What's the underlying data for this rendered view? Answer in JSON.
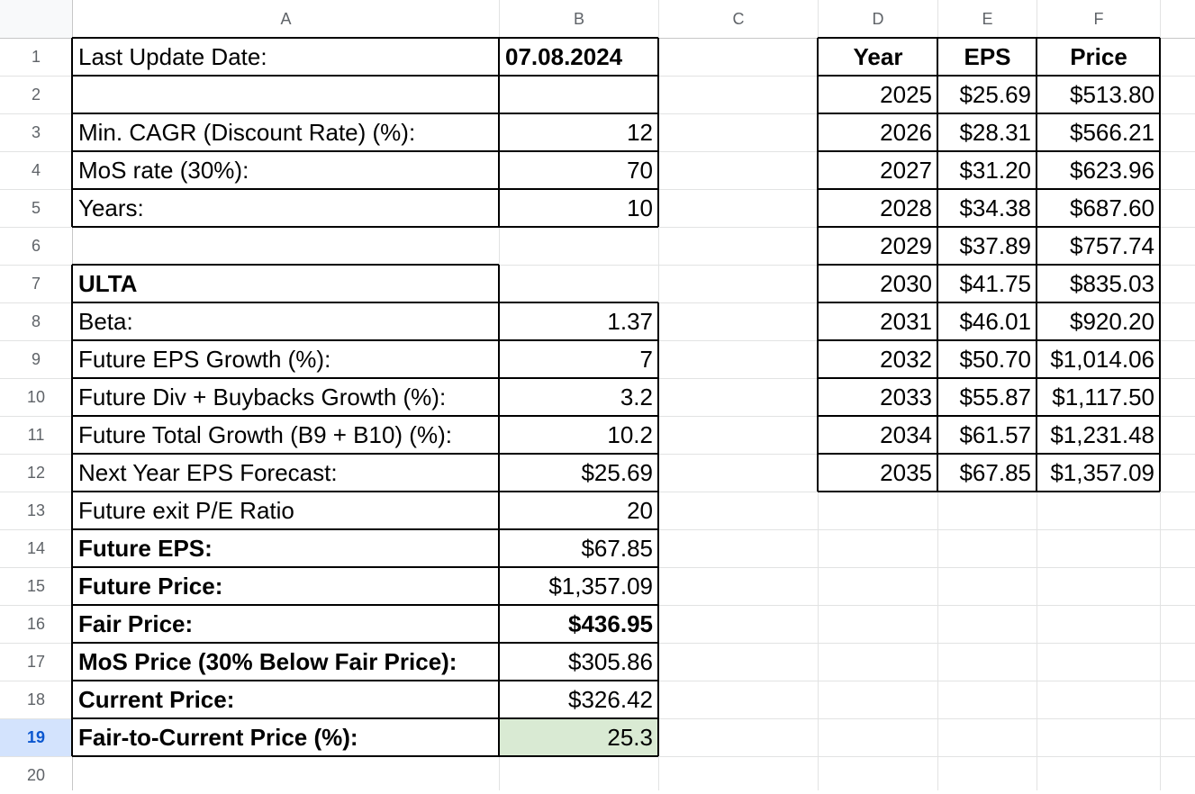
{
  "columns": [
    "A",
    "B",
    "C",
    "D",
    "E",
    "F"
  ],
  "rows": [
    "1",
    "2",
    "3",
    "4",
    "5",
    "6",
    "7",
    "8",
    "9",
    "10",
    "11",
    "12",
    "13",
    "14",
    "15",
    "16",
    "17",
    "18",
    "19",
    "20"
  ],
  "selected_row": 19,
  "colors": {
    "selected_header_bg": "#d3e3fd",
    "selected_header_text": "#0b57d0",
    "highlight_fill": "#d9ead3",
    "gridline": "#e2e3e3"
  },
  "sheet": {
    "last_update_label": "Last Update Date:",
    "last_update_value": "07.08.2024",
    "inputs": [
      {
        "label": "Min. CAGR (Discount Rate) (%):",
        "value": "12"
      },
      {
        "label": "MoS rate (30%):",
        "value": "70"
      },
      {
        "label": "Years:",
        "value": "10"
      }
    ],
    "ticker": "ULTA",
    "metrics": [
      {
        "label": "Beta:",
        "value": "1.37",
        "bold": false
      },
      {
        "label": "Future EPS Growth (%):",
        "value": "7",
        "bold": false
      },
      {
        "label": "Future Div + Buybacks Growth (%):",
        "value": "3.2",
        "bold": false
      },
      {
        "label": "Future Total Growth (B9 + B10) (%):",
        "value": "10.2",
        "bold": false
      },
      {
        "label": "Next Year EPS Forecast:",
        "value": "$25.69",
        "bold": false
      },
      {
        "label": "Future exit P/E Ratio",
        "value": "20",
        "bold": false
      },
      {
        "label": "Future EPS:",
        "value": "$67.85",
        "bold": true
      },
      {
        "label": "Future Price:",
        "value": "$1,357.09",
        "bold": true
      },
      {
        "label": "Fair Price:",
        "value": "$436.95",
        "bold": true,
        "value_bold": true
      },
      {
        "label": "MoS Price (30% Below Fair Price):",
        "value": "$305.86",
        "bold": true
      },
      {
        "label": "Current Price:",
        "value": "$326.42",
        "bold": true
      },
      {
        "label": "Fair-to-Current Price (%):",
        "value": "25.3",
        "bold": true,
        "highlight": true
      }
    ]
  },
  "projection": {
    "headers": [
      "Year",
      "EPS",
      "Price"
    ],
    "rows": [
      [
        "2025",
        "$25.69",
        "$513.80"
      ],
      [
        "2026",
        "$28.31",
        "$566.21"
      ],
      [
        "2027",
        "$31.20",
        "$623.96"
      ],
      [
        "2028",
        "$34.38",
        "$687.60"
      ],
      [
        "2029",
        "$37.89",
        "$757.74"
      ],
      [
        "2030",
        "$41.75",
        "$835.03"
      ],
      [
        "2031",
        "$46.01",
        "$920.20"
      ],
      [
        "2032",
        "$50.70",
        "$1,014.06"
      ],
      [
        "2033",
        "$55.87",
        "$1,117.50"
      ],
      [
        "2034",
        "$61.57",
        "$1,231.48"
      ],
      [
        "2035",
        "$67.85",
        "$1,357.09"
      ]
    ]
  }
}
